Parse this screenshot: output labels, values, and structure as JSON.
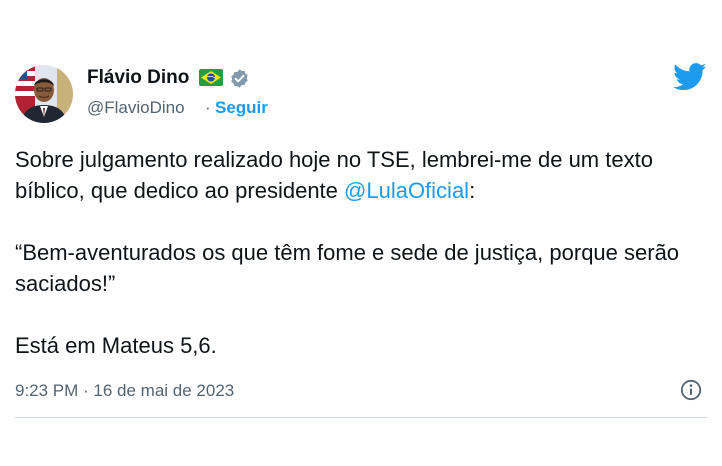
{
  "author": {
    "name": "Flávio Dino",
    "handle": "@FlavioDino",
    "separator": "·",
    "follow_label": "Seguir",
    "flag_icon": "brazil-flag-icon",
    "verified_icon": "verified-badge-icon"
  },
  "tweet": {
    "line1_before": "Sobre julgamento realizado hoje no TSE, lembrei-me de um texto bíblico, que dedico ao presidente ",
    "mention": "@LulaOficial",
    "line1_after": ":",
    "quote": "“Bem-aventurados os que têm fome e sede de justiça, porque serão saciados!”",
    "closing": "Está em Mateus 5,6."
  },
  "meta": {
    "timestamp": "9:23 PM · 16 de mai de 2023",
    "info_icon": "info-icon"
  },
  "colors": {
    "accent": "#1d9bf0",
    "text": "#0f1419",
    "muted": "#536471"
  }
}
